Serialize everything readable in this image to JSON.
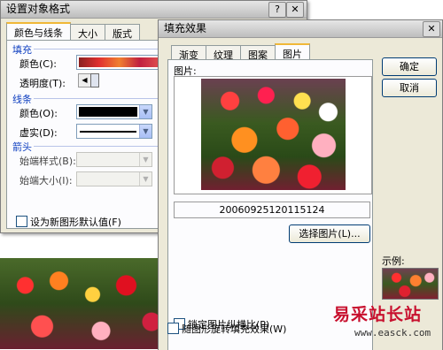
{
  "format_dialog": {
    "title": "设置对象格式",
    "tabs": [
      "颜色与线条",
      "大小",
      "版式"
    ],
    "fill_section": "填充",
    "fill_color_label": "颜色(C):",
    "transparency_label": "透明度(T):",
    "line_section": "线条",
    "line_color_label": "颜色(O):",
    "dash_label": "虚实(D):",
    "arrow_section": "箭头",
    "begin_style_label": "始端样式(B):",
    "begin_size_label": "始端大小(I):",
    "default_checkbox_label": "设为新图形默认值(F)"
  },
  "fill_effects_dialog": {
    "title": "填充效果",
    "tabs": [
      "渐变",
      "纹理",
      "图案",
      "图片"
    ],
    "picture_label": "图片:",
    "file_name": "20060925120115124",
    "select_picture_button": "选择图片(L)...",
    "lock_aspect_label": "锁定图片纵横比(P)",
    "rotate_with_shape_label": "随图形旋转填充效果(W)",
    "ok_button": "确定",
    "cancel_button": "取消",
    "sample_label": "示例:"
  },
  "watermark": {
    "site_name": "易采站长站",
    "url": "www.easck.com"
  },
  "colors": {
    "dialog_bg": "#ece9d8",
    "section_blue": "#1040c0",
    "watermark_red": "#c8102e"
  }
}
